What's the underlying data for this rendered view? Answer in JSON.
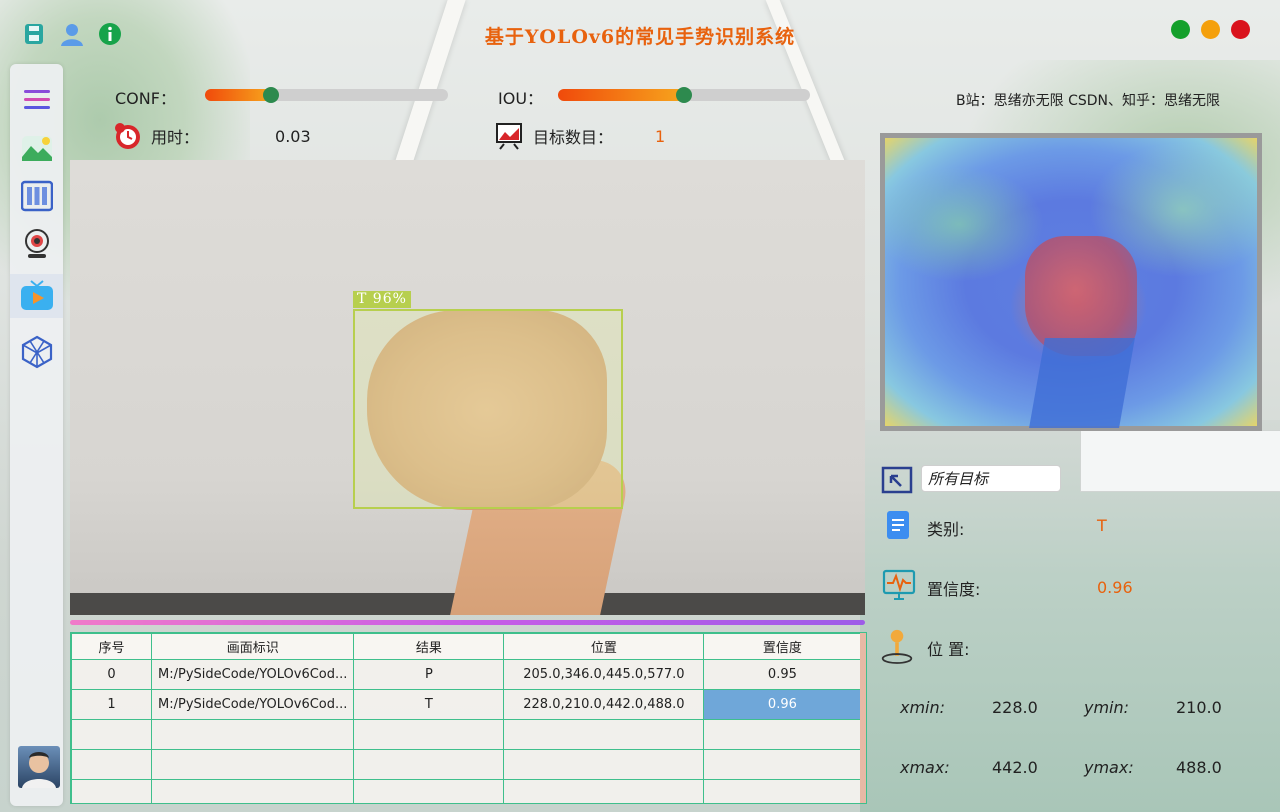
{
  "title": "基于YOLOv6的常见手势识别系统",
  "window_buttons": {
    "green": "#14a02b",
    "yellow": "#f4a00c",
    "red": "#d9121c"
  },
  "controls": {
    "conf_label": "CONF：",
    "conf_value": 0.27,
    "iou_label": "IOU：",
    "iou_value": 0.5,
    "time_label": "用时：",
    "time_value": "0.03",
    "count_label": "目标数目：",
    "count_value": "1"
  },
  "credits": "B站：思绪亦无限  CSDN、知乎：思绪无限",
  "detection": {
    "label": "T  96%",
    "box_color": "#b7cf4e"
  },
  "table": {
    "headers": [
      "序号",
      "画面标识",
      "结果",
      "位置",
      "置信度"
    ],
    "rows": [
      [
        "0",
        "M:/PySideCode/YOLOv6Cod...",
        "P",
        "205.0,346.0,445.0,577.0",
        "0.95"
      ],
      [
        "1",
        "M:/PySideCode/YOLOv6Cod...",
        "T",
        "228.0,210.0,442.0,488.0",
        "0.96"
      ],
      [
        "",
        "",
        "",
        "",
        ""
      ],
      [
        "",
        "",
        "",
        "",
        ""
      ],
      [
        "",
        "",
        "",
        "",
        ""
      ]
    ],
    "selected_row": 1
  },
  "right_panel": {
    "target_select": "所有目标",
    "class_label": "类别:",
    "class_value": "T",
    "conf_label": "置信度:",
    "conf_value": "0.96",
    "position_label": "位 置:",
    "xmin_label": "xmin:",
    "xmin_value": "228.0",
    "ymin_label": "ymin:",
    "ymin_value": "210.0",
    "xmax_label": "xmax:",
    "xmax_value": "442.0",
    "ymax_label": "ymax:",
    "ymax_value": "488.0"
  },
  "colors": {
    "accent_orange": "#e8620e",
    "table_border": "#3fbf8c",
    "selected_cell": "#6fa7d9"
  }
}
